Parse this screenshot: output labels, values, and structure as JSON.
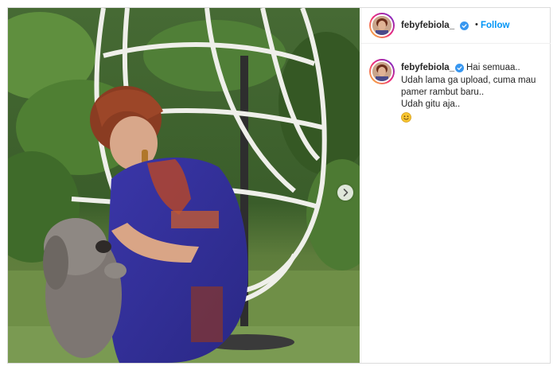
{
  "post": {
    "username": "febyfebiola_",
    "separator": "•",
    "follow_label": "Follow",
    "caption_first": "Hai semuaa..",
    "caption_lines": [
      "Udah lama ga upload, cuma mau",
      "pamer rambut baru..",
      "Udah gitu aja.."
    ],
    "caption_emoji": "slightly-smiling-face"
  },
  "icons": {
    "verified": "verified-badge-icon",
    "next": "chevron-right-icon"
  },
  "colors": {
    "follow_blue": "#0095f6",
    "verified_blue": "#3897f0",
    "text": "#262626",
    "border": "#dbdbdb"
  }
}
